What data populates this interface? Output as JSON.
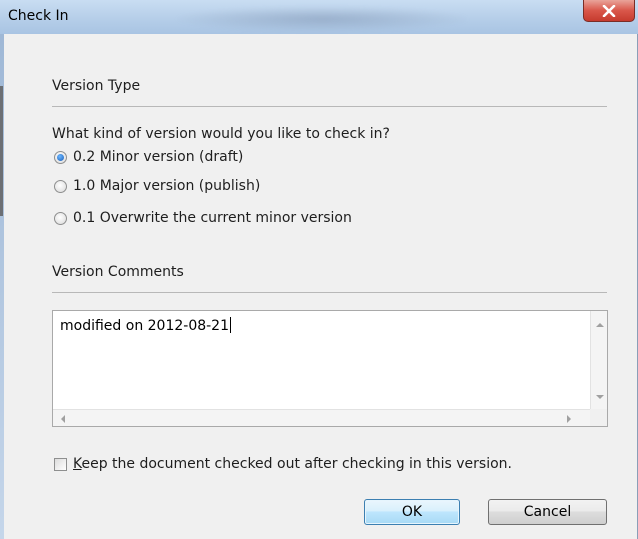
{
  "window": {
    "title": "Check In",
    "close_icon": "close-icon"
  },
  "version_type": {
    "heading": "Version Type",
    "question": "What kind of version would you like to check in?",
    "options": [
      {
        "label": "0.2 Minor version (draft)",
        "checked": true
      },
      {
        "label": "1.0 Major version (publish)",
        "checked": false
      },
      {
        "label": "0.1 Overwrite the current minor version",
        "checked": false
      }
    ]
  },
  "comments": {
    "heading": "Version Comments",
    "value": "modified on 2012-08-21"
  },
  "keep_checked_out": {
    "accel": "K",
    "rest": "eep the document checked out after checking in this version.",
    "checked": false
  },
  "buttons": {
    "ok": "OK",
    "cancel": "Cancel"
  },
  "colors": {
    "default_button_border": "#3c7fb1",
    "close_button": "#d9574a",
    "dialog_background": "#f0f0f0"
  }
}
